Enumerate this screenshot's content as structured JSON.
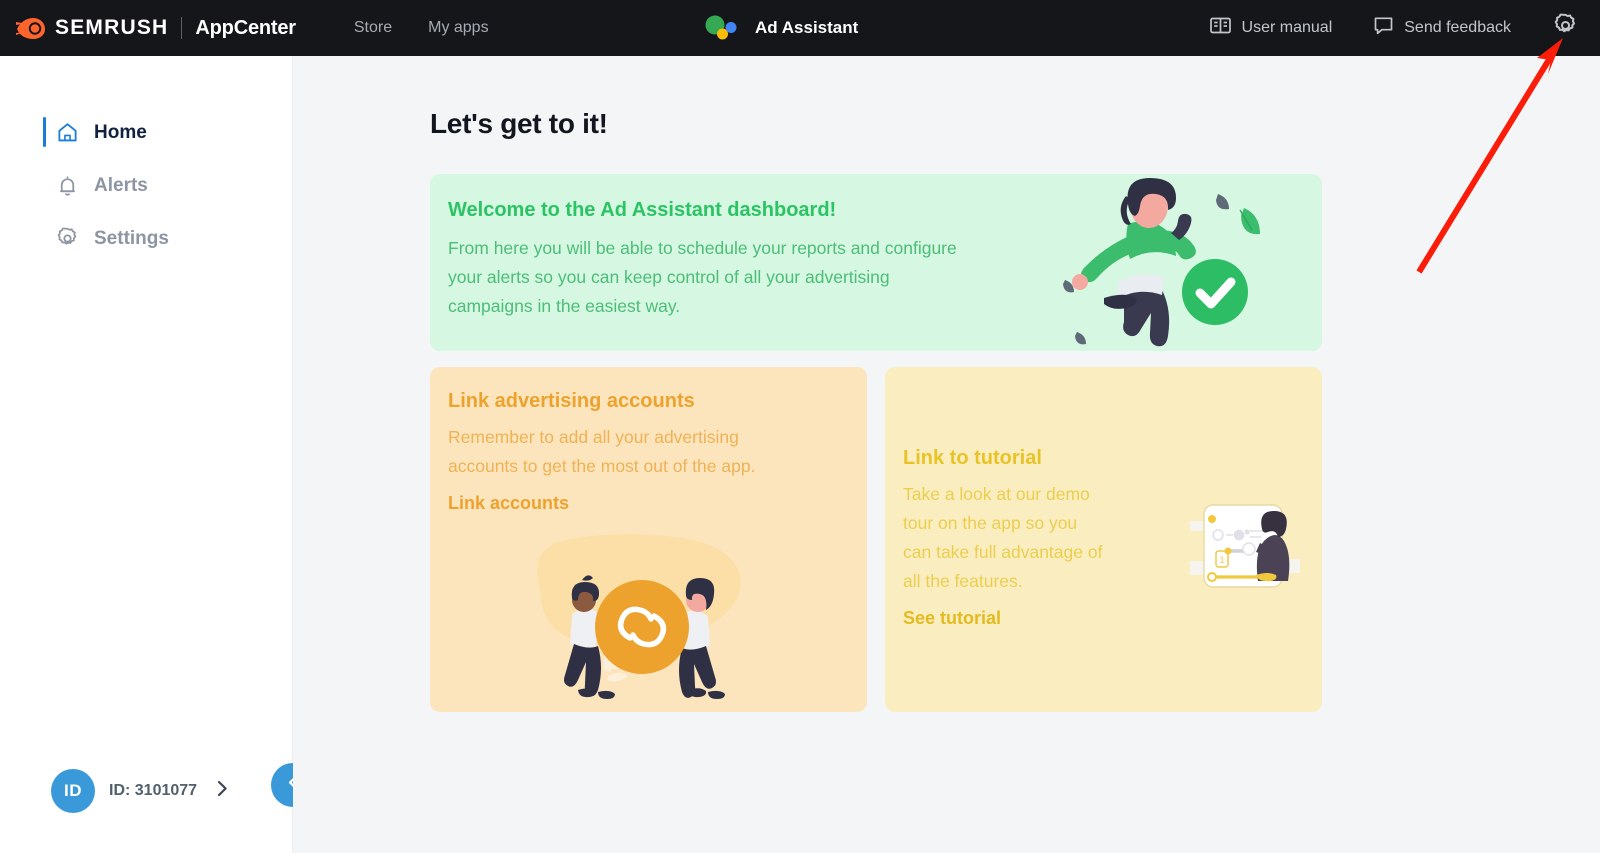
{
  "topbar": {
    "brand_name": "SEMRUSH",
    "brand_product": "AppCenter",
    "logo_icon": "semrush-comet-icon",
    "nav": [
      {
        "label": "Store"
      },
      {
        "label": "My apps"
      }
    ],
    "app": {
      "logo_icon": "ad-assistant-dots-icon",
      "title": "Ad Assistant"
    },
    "right_items": [
      {
        "label": "User manual",
        "icon": "book-icon"
      },
      {
        "label": "Send feedback",
        "icon": "speech-bubble-icon"
      }
    ],
    "settings_icon": "gear-icon",
    "bg_color": "#14161a"
  },
  "sidebar": {
    "items": [
      {
        "label": "Home",
        "icon": "home-icon",
        "active": true
      },
      {
        "label": "Alerts",
        "icon": "bell-icon",
        "active": false
      },
      {
        "label": "Settings",
        "icon": "gear-icon",
        "active": false
      }
    ],
    "account": {
      "avatar_text": "ID",
      "label": "ID: 3101077",
      "chevron_icon": "chevron-right-icon"
    },
    "collapse_icon": "chevron-left-icon",
    "accent_color": "#3a9ad9"
  },
  "main": {
    "page_title": "Let's get to it!",
    "cards": [
      {
        "id": "welcome",
        "heading": "Welcome to the Ad Assistant dashboard!",
        "body": "From here you will be able to schedule your reports and configure your alerts so you can keep control of all your advertising campaigns in the easiest way.",
        "bg_color": "#d6f7e1",
        "heading_color": "#2bc464",
        "illustration": "woman-jumping-with-checkmark-illustration"
      },
      {
        "id": "link-accounts",
        "heading": "Link advertising accounts",
        "body": "Remember to add all your advertising accounts to get the most out of the app.",
        "link_label": "Link accounts",
        "bg_color": "#fce5bd",
        "heading_color": "#eda22e",
        "illustration": "two-people-holding-link-coin-illustration"
      },
      {
        "id": "tutorial",
        "heading": "Link to tutorial",
        "body": "Take a look at our demo tour on the app so you can take full advantage of all the features.",
        "link_label": "See tutorial",
        "bg_color": "#faeec1",
        "heading_color": "#e9c326",
        "illustration": "presenter-at-whiteboard-illustration"
      }
    ],
    "bg_color": "#f4f5f7"
  },
  "annotation": {
    "type": "arrow",
    "color": "#fa1d0a",
    "points_to": "gear-icon"
  }
}
